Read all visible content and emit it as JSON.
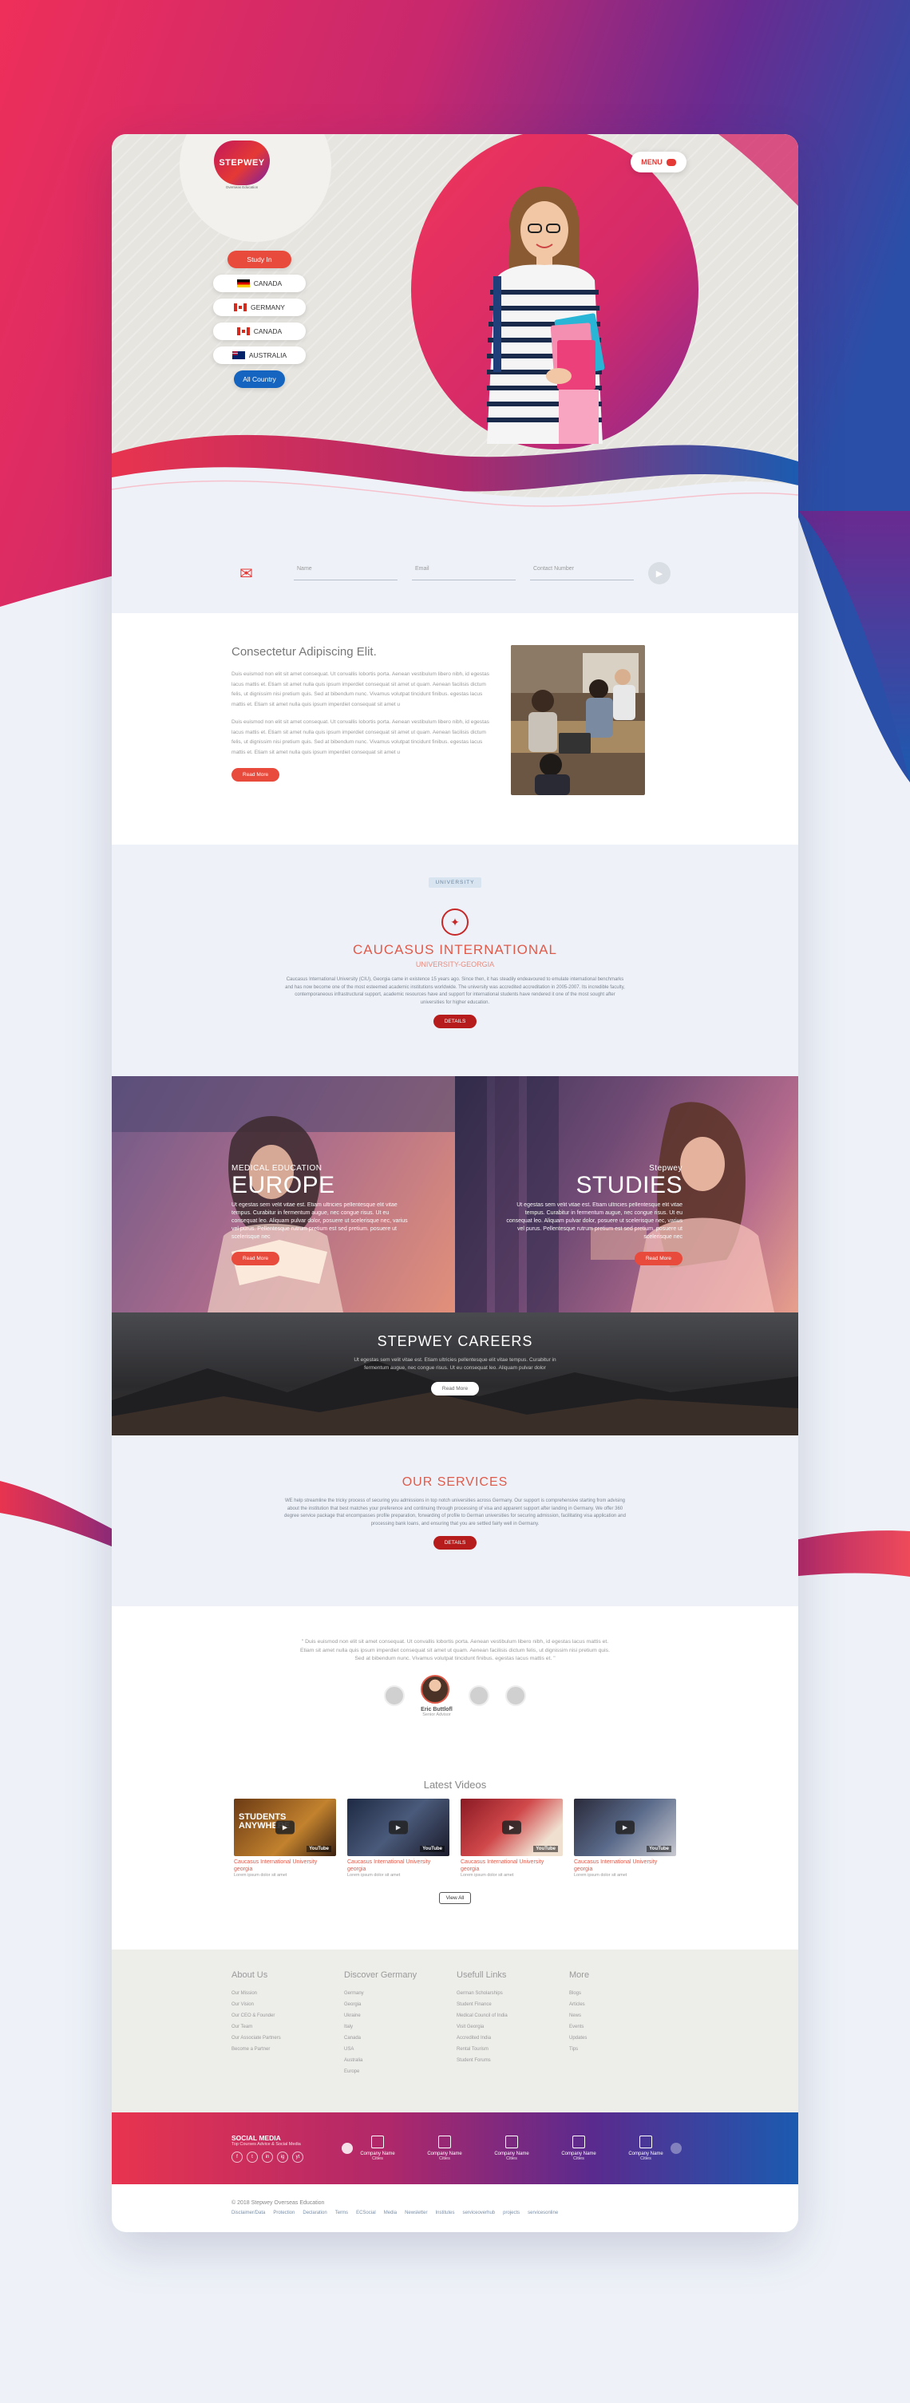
{
  "brand": {
    "name": "STEPWEY",
    "tagline": "Overseas Education",
    "accent": "#e84a3c",
    "dark_red": "#b71c1c",
    "blue": "#1565c0"
  },
  "header": {
    "menu_label": "MENU"
  },
  "study_in": {
    "label": "Study In",
    "countries": [
      "CANADA",
      "GERMANY",
      "CANADA",
      "AUSTRALIA"
    ],
    "all_label": "All Country"
  },
  "contact_form": {
    "name_placeholder": "Name",
    "email_placeholder": "Email",
    "phone_placeholder": "Contact Number"
  },
  "about": {
    "title": "Consectetur Adipiscing Elit.",
    "para1": "Duis euismod non elit sit amet consequat. Ut convallis lobortis porta. Aenean vestibulum libero nibh, id egestas lacus mattis et. Etiam sit amet nulla quis ipsum imperdiet consequat sit amet ut quam. Aenean facilisis dictum felis, ut dignissim nisi pretium quis. Sed at bibendum nunc. Vivamus volutpat tincidunt finibus. egestas lacus mattis et. Etiam sit amet nulla quis ipsum imperdiet consequat sit amet u",
    "para2": "Duis euismod non elit sit amet consequat. Ut convallis lobortis porta. Aenean vestibulum libero nibh, id egestas lacus mattis et. Etiam sit amet nulla quis ipsum imperdiet consequat sit amet ut quam. Aenean facilisis dictum felis, ut dignissim nisi pretium quis. Sed at bibendum nunc. Vivamus volutpat tincidunt finibus. egestas lacus mattis et. Etiam sit amet nulla quis ipsum imperdiet consequat sit amet u",
    "button": "Read More"
  },
  "university": {
    "tag": "UNIVERSITY",
    "title": "CAUCASUS INTERNATIONAL",
    "subtitle": "UNIVERSITY-GEORGIA",
    "description": "Caucasus International University (CIU), Georgia came in existence 15 years ago. Since then, it has steadily endeavoured to emulate international benchmarks and has now become one of the most esteemed academic institutions worldwide. The university was accredited accreditation in 2005-2007. Its incredible faculty, contemporaneous infrastructural support, academic resources have and support for international students have rendered it one of the most sought after universities for higher education.",
    "button": "DETAILS"
  },
  "panels": {
    "left": {
      "small": "MEDICAL EDUCATION",
      "big": "EUROPE",
      "para": "Ut egestas sem velit vitae est. Etiam ultricies pellentesque elit vitae tempus. Curabitur in fermentum augue, nec congue risus. Ut eu consequat leo. Aliquam pulvar dolor, posuere ut scelerisque nec, varius vel purus. Pellentesque rutrum pretium est sed pretium. posuere ut scelerisque nec",
      "button": "Read More"
    },
    "right": {
      "small": "Stepwey",
      "big": "STUDIES",
      "para": "Ut egestas sem velit vitae est. Etiam ultricies pellentesque elit vitae tempus. Curabitur in fermentum augue, nec congue risus. Ut eu consequat leo. Aliquam pulvar dolor, posuere ut scelerisque nec, varius vel purus. Pellentesque rutrum pretium est sed pretium. posuere ut scelerisque nec",
      "button": "Read More"
    },
    "careers": {
      "title": "STEPWEY CAREERS",
      "para": "Ut egestas sem velit vitae est. Etiam ultricies pellentesque elit vitae tempus. Curabitur in fermentum augue, nec congue risus. Ut eu consequat leo. Aliquam pulvar dolor",
      "button": "Read More"
    }
  },
  "services": {
    "title": "OUR SERVICES",
    "description": "WE help streamline the tricky process of securing you admissions in top notch universities across Germany. Our support is comprehensive starting from advising about the institution that best matches your preference and continuing through processing of visa and apparent support after landing in Germany. We offer 360 degree service package that encompasses profile preparation, forwarding of profile to German universities for securing admission, facilitating visa application and processing bank loans, and ensuring that you are settled fairly well in Germany.",
    "button": "DETAILS"
  },
  "testimonial": {
    "quote": "\" Duis euismod non elit sit amet consequat. Ut convallis lobortis porta. Aenean vestibulum libero nibh, id egestas lacus mattis et. Etiam sit amet nulla quis ipsum imperdiet consequat sit amet ut quam. Aenean facilisis dictum felis, ut dignissim nisi pretium quis. Sed at bibendum nunc. Vivamus volutpat tincidunt finibus. egestas lacus mattis et. \"",
    "name": "Eric Buttlofl",
    "role": "Senior Advisor"
  },
  "videos": {
    "title": "Latest Videos",
    "items": [
      {
        "title": "Caucasus International University georgia",
        "sub": "Lorem ipsum dolor sit amet",
        "overlay": "STUDENTS ANYWHERE"
      },
      {
        "title": "Caucasus International University georgia",
        "sub": "Lorem ipsum dolor sit amet",
        "overlay": ""
      },
      {
        "title": "Caucasus International University georgia",
        "sub": "Lorem ipsum dolor sit amet",
        "overlay": ""
      },
      {
        "title": "Caucasus International University georgia",
        "sub": "Lorem ipsum dolor sit amet",
        "overlay": ""
      }
    ],
    "view_all": "View All"
  },
  "footer": {
    "columns": [
      {
        "title": "About Us",
        "items": [
          "Our Mission",
          "Our Vision",
          "Our CEO & Founder",
          "Our Team",
          "Our Associate Partners",
          "Become a Partner"
        ]
      },
      {
        "title": "Discover Germany",
        "items": [
          "Germany",
          "Georgia",
          "Ukraine",
          "Italy",
          "Canada",
          "USA",
          "Australia",
          "Europe"
        ]
      },
      {
        "title": "Usefull Links",
        "items": [
          "German Scholarships",
          "Student Finance",
          "Medical Council of India",
          "Visit Georgia",
          "Accredited India",
          "Rental Tourism",
          "Student Forums"
        ]
      },
      {
        "title": "More",
        "items": [
          "Blogs",
          "Articles",
          "News",
          "Events",
          "Updates",
          "Tips"
        ]
      }
    ]
  },
  "social": {
    "title": "SOCIAL MEDIA",
    "subtitle": "Top Courses Advice & Social Media",
    "icons": [
      "f",
      "t",
      "in",
      "ig",
      "yt"
    ],
    "companies": [
      {
        "name": "Company Name",
        "city": "Cities"
      },
      {
        "name": "Company Name",
        "city": "Cities"
      },
      {
        "name": "Company Name",
        "city": "Cities"
      },
      {
        "name": "Company Name",
        "city": "Cities"
      },
      {
        "name": "Company Name",
        "city": "Cities"
      }
    ]
  },
  "bottom": {
    "copyright": "© 2018 Stepwey Overseas Education",
    "links": [
      "Disclaimer/Data",
      "Protection",
      "Declaration",
      "Terms",
      "ECSocial",
      "Media",
      "Newsletter",
      "Institutes",
      "serviceoverhub",
      "projects",
      "servicesonline"
    ]
  }
}
